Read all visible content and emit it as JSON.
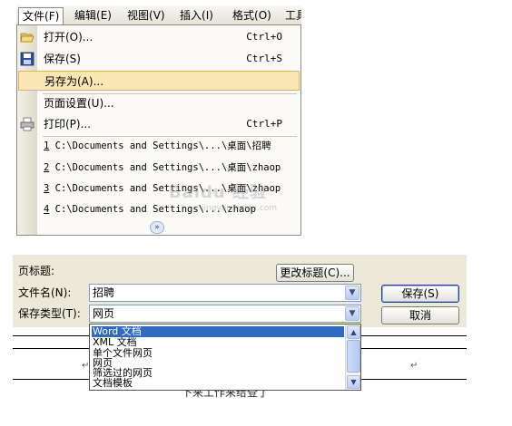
{
  "menubar": {
    "items": [
      {
        "label": "文件",
        "mnemonic": "(F)"
      },
      {
        "label": "编辑",
        "mnemonic": "(E)"
      },
      {
        "label": "视图",
        "mnemonic": "(V)"
      },
      {
        "label": "插入",
        "mnemonic": "(I)"
      },
      {
        "label": "格式",
        "mnemonic": "(O)"
      },
      {
        "label": "工具",
        "mnemonic": ""
      }
    ]
  },
  "file_menu": {
    "items": [
      {
        "label": "打开(O)...",
        "shortcut": "Ctrl+O",
        "icon": "open-folder-icon"
      },
      {
        "label": "保存(S)",
        "shortcut": "Ctrl+S",
        "icon": "floppy-disk-icon"
      },
      {
        "label": "另存为(A)...",
        "shortcut": "",
        "icon": ""
      },
      {
        "label": "页面设置(U)...",
        "shortcut": "",
        "icon": ""
      },
      {
        "label": "打印(P)...",
        "shortcut": "Ctrl+P",
        "icon": "printer-icon"
      }
    ],
    "recent": [
      {
        "index": "1",
        "path": "C:\\Documents and Settings\\...\\桌面\\招聘"
      },
      {
        "index": "2",
        "path": "C:\\Documents and Settings\\...\\桌面\\zhaop"
      },
      {
        "index": "3",
        "path": "C:\\Documents and Settings\\...\\桌面\\zhaop"
      },
      {
        "index": "4",
        "path": "C:\\Documents and Settings\\...\\zhaop"
      }
    ],
    "expand_glyph": "»"
  },
  "watermark": {
    "text": "Baidu 经验",
    "sub": "jingyan.baidu.com"
  },
  "save_dialog": {
    "page_title_label": "页标题:",
    "change_title_button": "更改标题(C)...",
    "filename_label": "文件名(N):",
    "filename_value": "招聘",
    "savetype_label": "保存类型(T):",
    "savetype_value": "网页",
    "save_button": "保存(S)",
    "cancel_button": "取消"
  },
  "type_list": {
    "options": [
      "Word 文档",
      "XML 文档",
      "单个文件网页",
      "网页",
      "筛选过的网页",
      "文档模板"
    ],
    "selected_index": 0
  },
  "document": {
    "para_mark": "↵",
    "footer_text": "下来工作来给登了"
  },
  "colors": {
    "menu_highlight": "#fbe6b5",
    "selection_blue": "#316ac5",
    "dialog_bg": "#ece9d8"
  }
}
